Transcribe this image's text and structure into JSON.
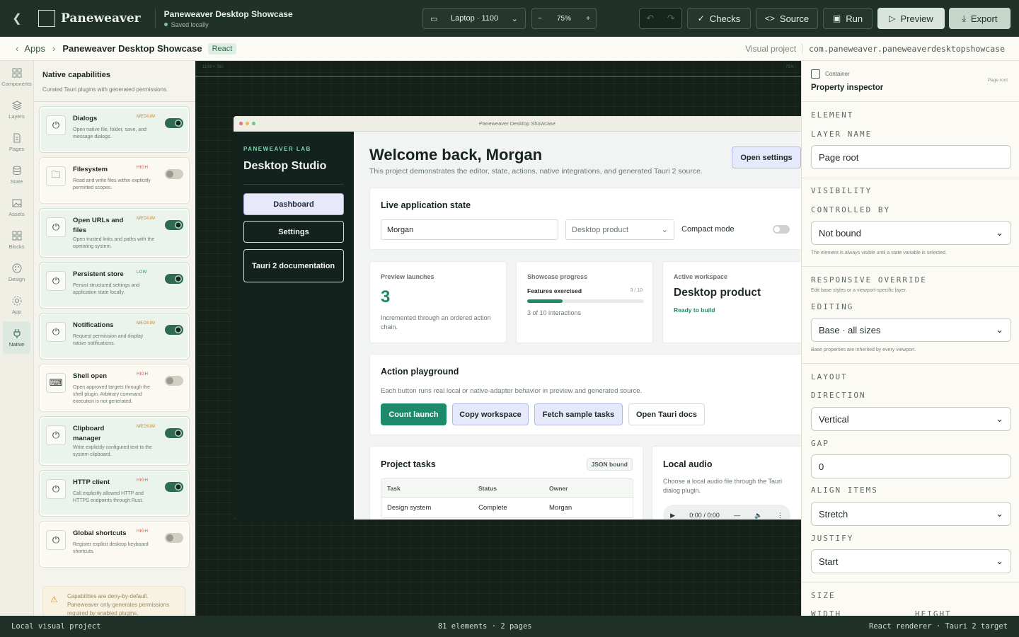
{
  "topbar": {
    "brand": "Paneweaver",
    "project_title": "Paneweaver Desktop Showcase",
    "save_status": "Saved locally",
    "device": "Laptop · 1100",
    "zoom": "75%",
    "checks": "Checks",
    "source": "Source",
    "run": "Run",
    "preview": "Preview",
    "export": "Export"
  },
  "breadcrumb": {
    "apps": "Apps",
    "title": "Paneweaver Desktop Showcase",
    "badge": "React",
    "kind": "Visual project",
    "bundle_id": "com.paneweaver.paneweaverdesktopshowcase"
  },
  "rail": [
    "Components",
    "Layers",
    "Pages",
    "State",
    "Assets",
    "Blocks",
    "Design",
    "App",
    "Native"
  ],
  "native": {
    "title": "Native capabilities",
    "subtitle": "Curated Tauri plugins with generated permissions.",
    "capabilities": [
      {
        "name": "Dialogs",
        "risk": "MEDIUM",
        "desc": "Open native file, folder, save, and message dialogs.",
        "enabled": true
      },
      {
        "name": "Filesystem",
        "risk": "HIGH",
        "desc": "Read and write files within explicitly permitted scopes.",
        "enabled": false
      },
      {
        "name": "Open URLs and files",
        "risk": "MEDIUM",
        "desc": "Open trusted links and paths with the operating system.",
        "enabled": true
      },
      {
        "name": "Persistent store",
        "risk": "LOW",
        "desc": "Persist structured settings and application state locally.",
        "enabled": true
      },
      {
        "name": "Notifications",
        "risk": "MEDIUM",
        "desc": "Request permission and display native notifications.",
        "enabled": true
      },
      {
        "name": "Shell open",
        "risk": "HIGH",
        "desc": "Open approved targets through the shell plugin. Arbitrary command execution is not generated.",
        "enabled": false
      },
      {
        "name": "Clipboard manager",
        "risk": "MEDIUM",
        "desc": "Write explicitly configured text to the system clipboard.",
        "enabled": true
      },
      {
        "name": "HTTP client",
        "risk": "HIGH",
        "desc": "Call explicitly allowed HTTP and HTTPS endpoints through Rust.",
        "enabled": true
      },
      {
        "name": "Global shortcuts",
        "risk": "HIGH",
        "desc": "Register explicit desktop keyboard shortcuts.",
        "enabled": false
      }
    ],
    "note": "Capabilities are deny-by-default. Paneweaver only generates permissions required by enabled plugins."
  },
  "canvas": {
    "size_label": "1100 × 760",
    "zoom_label": "75%",
    "window_title": "Paneweaver Desktop Showcase"
  },
  "app": {
    "lab": "PANEWEAVER LAB",
    "studio": "Desktop Studio",
    "nav": [
      "Dashboard",
      "Settings",
      "Tauri 2 documentation"
    ],
    "welcome": "Welcome back, Morgan",
    "welcome_sub": "This project demonstrates the editor, state, actions, native integrations, and generated Tauri 2 source.",
    "open_settings": "Open settings",
    "live_state_title": "Live application state",
    "name_value": "Morgan",
    "product_select": "Desktop product",
    "compact_mode": "Compact mode",
    "launches_label": "Preview launches",
    "launches_value": "3",
    "launches_desc": "Incremented through an ordered action chain.",
    "progress_label": "Showcase progress",
    "progress_item": "Features exercised",
    "progress_count": "3 / 10",
    "progress_fraction": 0.3,
    "progress_text": "3 of 10 interactions",
    "workspace_label": "Active workspace",
    "workspace_value": "Desktop product",
    "workspace_status": "Ready to build",
    "playground_title": "Action playground",
    "playground_desc": "Each button runs real local or native-adapter behavior in preview and generated source.",
    "buttons": [
      "Count launch",
      "Copy workspace",
      "Fetch sample tasks",
      "Open Tauri docs"
    ],
    "tasks_title": "Project tasks",
    "tasks_badge": "JSON bound",
    "tasks_headers": [
      "Task",
      "Status",
      "Owner"
    ],
    "tasks_rows": [
      [
        "Design system",
        "Complete",
        "Morgan"
      ]
    ],
    "audio_title": "Local audio",
    "audio_desc": "Choose a local audio file through the Tauri dialog plugin.",
    "audio_time": "0:00 / 0:00"
  },
  "inspector": {
    "kind": "Container",
    "title": "Property inspector",
    "root_tag": "Page root",
    "element": "ELEMENT",
    "layer_name_label": "LAYER NAME",
    "layer_name": "Page root",
    "visibility": "VISIBILITY",
    "controlled_by": "CONTROLLED BY",
    "controlled_value": "Not bound",
    "visibility_hint": "The element is always visible until a state variable is selected.",
    "responsive": "RESPONSIVE OVERRIDE",
    "responsive_hint": "Edit base styles or a viewport-specific layer.",
    "editing": "EDITING",
    "editing_value": "Base · all sizes",
    "editing_hint": "Base properties are inherited by every viewport.",
    "layout": "LAYOUT",
    "direction": "DIRECTION",
    "direction_value": "Vertical",
    "gap": "GAP",
    "gap_value": "0",
    "align": "ALIGN ITEMS",
    "align_value": "Stretch",
    "justify": "JUSTIFY",
    "justify_value": "Start",
    "size": "SIZE",
    "width": "WIDTH",
    "height": "HEIGHT"
  },
  "statusbar": {
    "left": "Local visual project",
    "center": "81 elements · 2 pages",
    "right": "React renderer · Tauri 2 target"
  }
}
